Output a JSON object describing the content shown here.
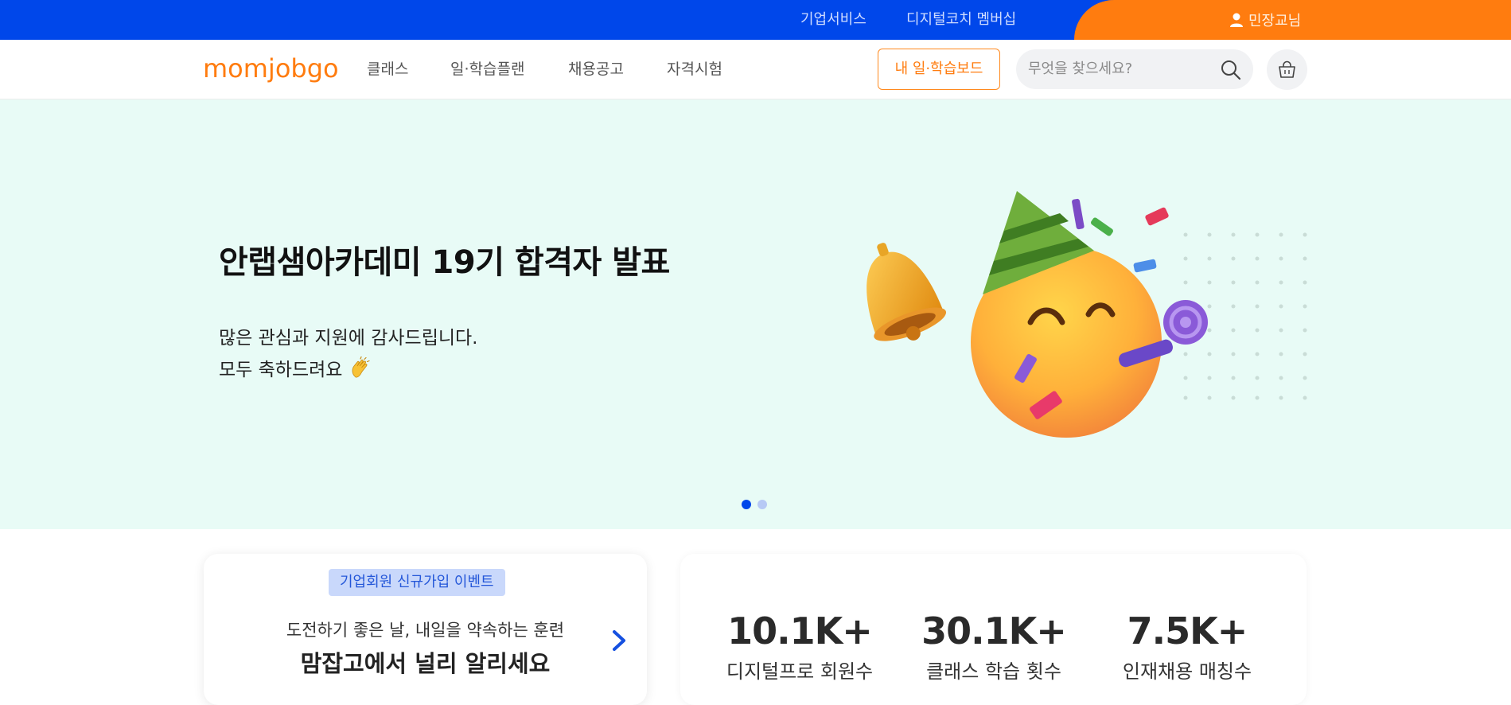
{
  "topbar": {
    "links": [
      "기업서비스",
      "디지털코치 멤버십"
    ],
    "user_name": "민장교님",
    "colors": {
      "blue": "#0047ea",
      "orange": "#ff7c0f"
    }
  },
  "header": {
    "logo_text": "momjobgo",
    "nav": [
      "클래스",
      "일·학습플랜",
      "채용공고",
      "자격시험"
    ],
    "board_button": "내 일·학습보드",
    "search_placeholder": "무엇을 찾으세요?",
    "icons": {
      "search": "search-icon",
      "cart": "basket-icon",
      "user": "user-icon"
    }
  },
  "hero": {
    "title": "안랩샘아카데미 19기 합격자 발표",
    "line1": "많은 관심과 지원에 감사드립니다.",
    "line2": "모두 축하드려요",
    "emoji": "clapping-hands-icon",
    "illustration": "party-face-icon",
    "background": "#e8fbf6",
    "slides_total": 2,
    "slide_active": 1
  },
  "event_card": {
    "badge": "기업회원 신규가입 이벤트",
    "sub": "도전하기 좋은 날, 내일을 약속하는 훈련",
    "main": "맘잡고에서 널리 알리세요"
  },
  "stats": [
    {
      "value": "10.1K+",
      "label": "디지털프로 회원수"
    },
    {
      "value": "30.1K+",
      "label": "클래스 학습 횟수"
    },
    {
      "value": "7.5K+",
      "label": "인재채용 매칭수"
    }
  ]
}
